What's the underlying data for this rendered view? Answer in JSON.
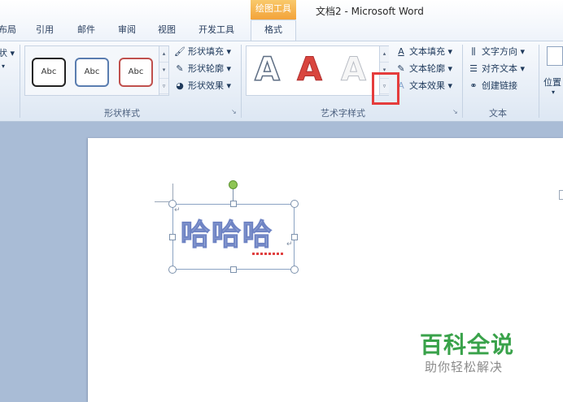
{
  "window": {
    "context_tab": "绘图工具",
    "title": "文档2 - Microsoft Word"
  },
  "tabs": [
    {
      "label": "布局"
    },
    {
      "label": "引用"
    },
    {
      "label": "邮件"
    },
    {
      "label": "审阅"
    },
    {
      "label": "视图"
    },
    {
      "label": "开发工具"
    },
    {
      "label": "格式"
    }
  ],
  "ribbon": {
    "partial_left": "状",
    "shape_styles": {
      "label": "形状样式",
      "swatch_text": "Abc",
      "fill": "形状填充",
      "outline": "形状轮廓",
      "effects": "形状效果"
    },
    "wordart_styles": {
      "label": "艺术字样式",
      "glyph": "A",
      "text_fill": "文本填充",
      "text_outline": "文本轮廓",
      "text_effects": "文本效果"
    },
    "text": {
      "label": "文本",
      "direction": "文字方向",
      "align": "对齐文本",
      "link": "创建链接"
    },
    "position": "位置"
  },
  "document": {
    "wordart": "哈哈哈",
    "paragraph_mark": "↵"
  },
  "watermark": {
    "title": "百科全说",
    "subtitle": "助你轻松解决"
  },
  "colors": {
    "accent_orange": "#f3a33a",
    "highlight_red": "#e53c3c",
    "watermark_green": "#39a24a"
  }
}
